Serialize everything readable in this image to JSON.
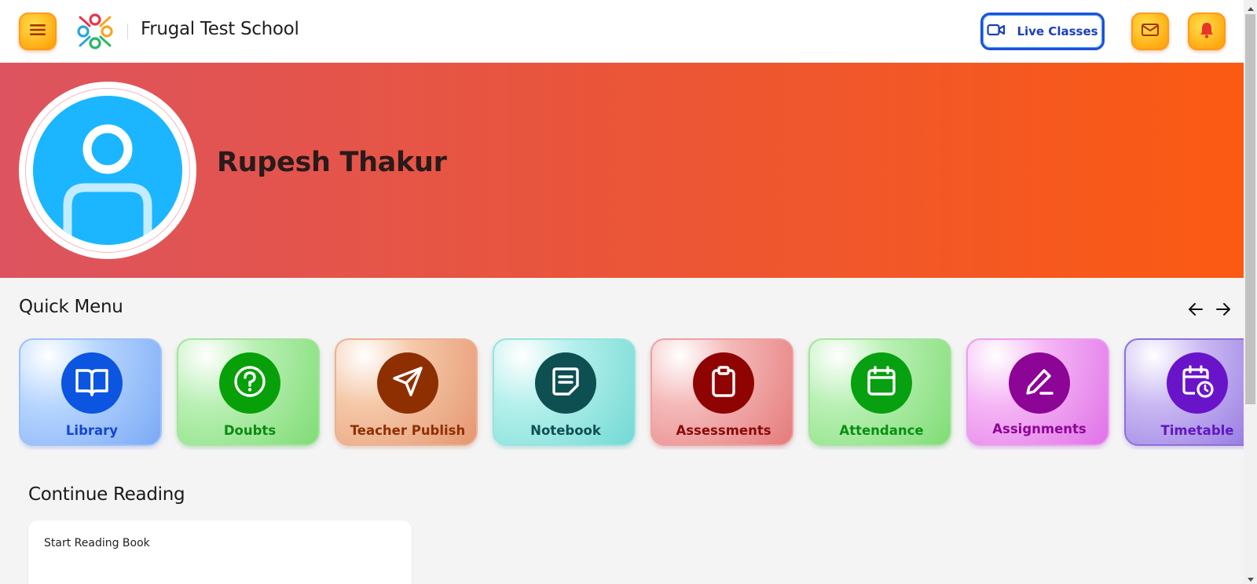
{
  "header": {
    "school_name": "Frugal Test School",
    "live_classes_label": "Live Classes"
  },
  "profile": {
    "name": "Rupesh Thakur"
  },
  "quick_menu": {
    "title": "Quick Menu",
    "items": [
      {
        "label": "Library",
        "icon": "book-open-icon",
        "circle": "#0c55e0",
        "label_color": "#1545d0"
      },
      {
        "label": "Doubts",
        "icon": "question-icon",
        "circle": "#08a008",
        "label_color": "#0d8a10"
      },
      {
        "label": "Teacher Publish",
        "icon": "send-icon",
        "circle": "#8e2f02",
        "label_color": "#8e2f02"
      },
      {
        "label": "Notebook",
        "icon": "notebook-icon",
        "circle": "#0e4f52",
        "label_color": "#0e4f52"
      },
      {
        "label": "Assessments",
        "icon": "clipboard-icon",
        "circle": "#8f0303",
        "label_color": "#8a0a0a"
      },
      {
        "label": "Attendance",
        "icon": "calendar-icon",
        "circle": "#07a010",
        "label_color": "#089010"
      },
      {
        "label": "Assignments",
        "icon": "pencil-icon",
        "circle": "#8d0596",
        "label_color": "#8d0596"
      },
      {
        "label": "Timetable",
        "icon": "calendar-clock-icon",
        "circle": "#6a14c9",
        "label_color": "#6116c2"
      }
    ]
  },
  "continue_reading": {
    "title": "Continue Reading",
    "card_text": "Start Reading Book"
  },
  "colors": {
    "banner_start": "#dd5460",
    "banner_end": "#fb5a12",
    "accent_yellow": "#ffb21a",
    "live_blue": "#1f4fd8"
  }
}
